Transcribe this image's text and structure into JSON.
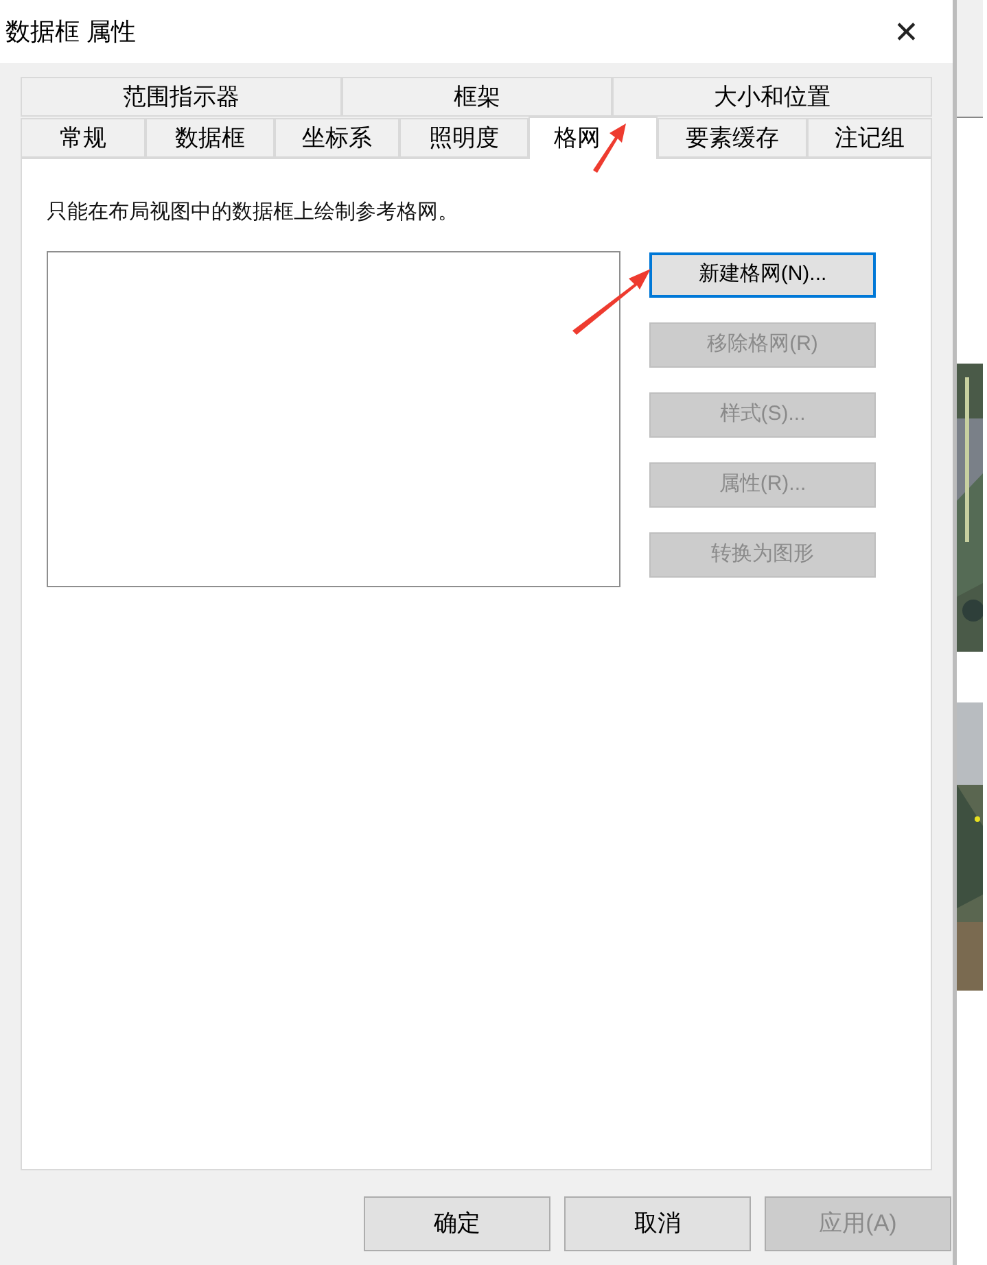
{
  "window": {
    "title": "数据框 属性",
    "close": "✕"
  },
  "tab_rows": [
    [
      {
        "label": "范围指示器",
        "selected": false
      },
      {
        "label": "框架",
        "selected": false
      },
      {
        "label": "大小和位置",
        "selected": false
      }
    ],
    [
      {
        "label": "常规",
        "selected": false
      },
      {
        "label": "数据框",
        "selected": false
      },
      {
        "label": "坐标系",
        "selected": false
      },
      {
        "label": "照明度",
        "selected": false
      },
      {
        "label": "格网",
        "selected": true
      },
      {
        "label": "要素缓存",
        "selected": false
      },
      {
        "label": "注记组",
        "selected": false
      }
    ]
  ],
  "hint": "只能在布局视图中的数据框上绘制参考格网。",
  "side_buttons": [
    {
      "label": "新建格网(N)...",
      "disabled": false,
      "focused": true
    },
    {
      "label": "移除格网(R)",
      "disabled": true,
      "focused": false
    },
    {
      "label": "样式(S)...",
      "disabled": true,
      "focused": false
    },
    {
      "label": "属性(R)...",
      "disabled": true,
      "focused": false
    },
    {
      "label": "转换为图形",
      "disabled": true,
      "focused": false
    }
  ],
  "footer_buttons": [
    {
      "label": "确定",
      "disabled": false
    },
    {
      "label": "取消",
      "disabled": false
    },
    {
      "label": "应用(A)",
      "disabled": true
    }
  ]
}
